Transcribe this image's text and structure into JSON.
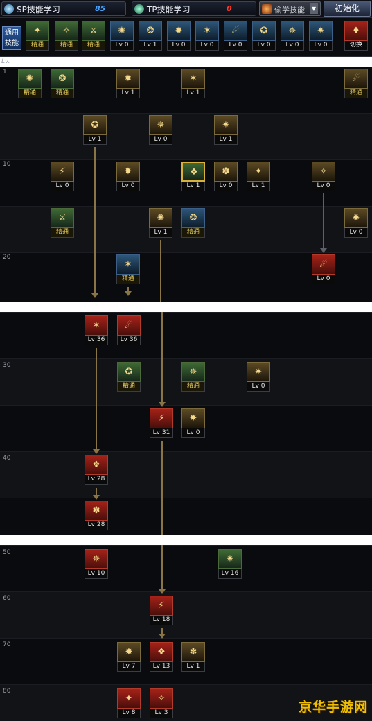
{
  "topbar": {
    "sp_label": "SP技能学习",
    "sp_value": "85",
    "tp_label": "TP技能学习",
    "tp_value": "0",
    "steal_label": "偷学技能",
    "init_label": "初始化",
    "sp_color": "#4aa3ff",
    "tp_color": "#ff3a2a"
  },
  "common": {
    "label_line1": "通用",
    "label_line2": "技能",
    "skills": [
      {
        "icon": "common-skill-1-icon",
        "lv": "精通",
        "master": true
      },
      {
        "icon": "common-skill-2-icon",
        "lv": "精通",
        "master": true
      },
      {
        "icon": "common-skill-3-icon",
        "lv": "精通",
        "master": true
      },
      {
        "icon": "common-skill-4-icon",
        "lv": "Lv 0"
      },
      {
        "icon": "common-skill-5-icon",
        "lv": "Lv 1"
      },
      {
        "icon": "common-skill-6-icon",
        "lv": "Lv 0"
      },
      {
        "icon": "common-skill-7-icon",
        "lv": "Lv 0"
      },
      {
        "icon": "common-skill-8-icon",
        "lv": "Lv 0"
      },
      {
        "icon": "common-skill-9-icon",
        "lv": "Lv 0"
      },
      {
        "icon": "common-skill-10-icon",
        "lv": "Lv 0"
      },
      {
        "icon": "common-skill-11-icon",
        "lv": "Lv 0"
      }
    ],
    "swap_label": "切换"
  },
  "lv_header": "Lv.",
  "levels": {
    "l1": "1",
    "l10": "10",
    "l20": "20",
    "l30": "30",
    "l40": "40",
    "l50": "50",
    "l60": "60",
    "l70": "70",
    "l80": "80"
  },
  "skills": {
    "p1": [
      {
        "lv": "精通",
        "master": true,
        "color": "green"
      },
      {
        "lv": "精通",
        "master": true,
        "color": "green"
      },
      {
        "lv": "Lv 1",
        "color": "gold"
      },
      {
        "lv": "Lv 1",
        "color": "gold"
      },
      {
        "lv": "精通",
        "master": true,
        "color": "gold"
      },
      {
        "lv": "Lv 1",
        "color": "gold"
      },
      {
        "lv": "Lv 0",
        "color": "gold"
      },
      {
        "lv": "Lv 1",
        "color": "gold"
      },
      {
        "lv": "Lv 0",
        "color": "gold"
      },
      {
        "lv": "Lv 0",
        "color": "gold"
      },
      {
        "lv": "Lv 1",
        "color": "green"
      },
      {
        "lv": "Lv 0",
        "color": "gold"
      },
      {
        "lv": "Lv 1",
        "color": "gold"
      },
      {
        "lv": "Lv 0",
        "color": "gold"
      },
      {
        "lv": "精通",
        "master": true,
        "color": "green"
      },
      {
        "lv": "Lv 1",
        "color": "gold"
      },
      {
        "lv": "精通",
        "master": true,
        "color": "blue"
      },
      {
        "lv": "Lv 0",
        "color": "gold"
      },
      {
        "lv": "精通",
        "master": true,
        "color": "blue"
      },
      {
        "lv": "Lv 0",
        "color": "red"
      }
    ],
    "p2": [
      {
        "lv": "Lv 36",
        "color": "red"
      },
      {
        "lv": "Lv 36",
        "color": "red"
      },
      {
        "lv": "精通",
        "master": true,
        "color": "green"
      },
      {
        "lv": "精通",
        "master": true,
        "color": "green"
      },
      {
        "lv": "Lv 0",
        "color": "gold"
      },
      {
        "lv": "Lv 31",
        "color": "red"
      },
      {
        "lv": "Lv 0",
        "color": "gold"
      },
      {
        "lv": "Lv 28",
        "color": "red"
      },
      {
        "lv": "Lv 28",
        "color": "red"
      }
    ],
    "p3": [
      {
        "lv": "Lv 10",
        "color": "red"
      },
      {
        "lv": "Lv 16",
        "color": "green"
      },
      {
        "lv": "Lv 18",
        "color": "red"
      },
      {
        "lv": "Lv 7",
        "color": "gold"
      },
      {
        "lv": "Lv 13",
        "color": "red"
      },
      {
        "lv": "Lv 1",
        "color": "gold"
      },
      {
        "lv": "Lv 8",
        "color": "red"
      },
      {
        "lv": "Lv 3",
        "color": "red"
      }
    ]
  },
  "watermark": "京华手游网"
}
